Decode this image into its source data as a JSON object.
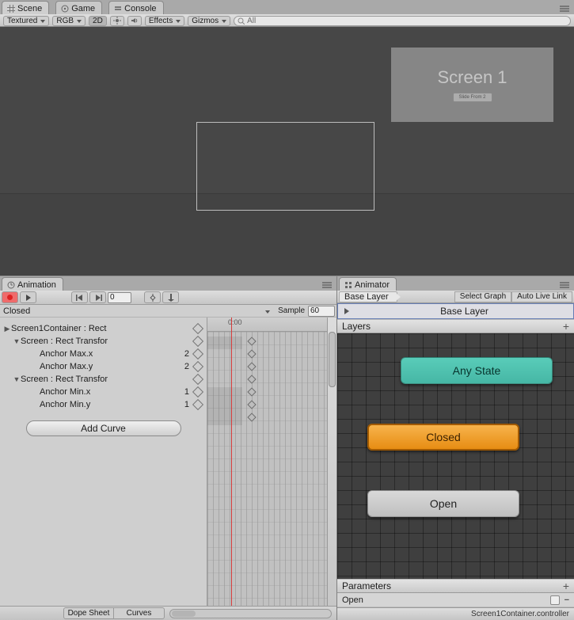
{
  "scene_tabs": {
    "scene": "Scene",
    "game": "Game",
    "console": "Console"
  },
  "scene_toolbar": {
    "render_mode": "Textured",
    "color_mode": "RGB",
    "btn_2d": "2D",
    "effects": "Effects",
    "gizmos": "Gizmos",
    "search_placeholder": "All"
  },
  "screen_card": {
    "title": "Screen 1",
    "subbtn": "Slide From 2"
  },
  "animation": {
    "tab": "Animation",
    "frame": "0",
    "clip": "Closed",
    "sample_label": "Sample",
    "sample_value": "60",
    "ruler0": "0:00",
    "add_curve": "Add Curve",
    "bottom_dope": "Dope Sheet",
    "bottom_curves": "Curves",
    "props": [
      {
        "indent": 0,
        "twist": "▶",
        "label": "Screen1Container : Rect",
        "val": "",
        "tint": "#a4cfa4"
      },
      {
        "indent": 1,
        "twist": "▼",
        "label": "Screen : Rect Transfor",
        "val": "",
        "tint": "#a4cfa4"
      },
      {
        "indent": 2,
        "twist": "",
        "label": "Anchor Max.x",
        "val": "2",
        "tint": "#a4cfa4"
      },
      {
        "indent": 2,
        "twist": "",
        "label": "Anchor Max.y",
        "val": "2",
        "tint": "#a4cfa4"
      },
      {
        "indent": 1,
        "twist": "▼",
        "label": "Screen : Rect Transfor",
        "val": "",
        "tint": "#a4cfa4"
      },
      {
        "indent": 2,
        "twist": "",
        "label": "Anchor Min.x",
        "val": "1",
        "tint": "#a4cfa4"
      },
      {
        "indent": 2,
        "twist": "",
        "label": "Anchor Min.y",
        "val": "1",
        "tint": "#a4cfa4"
      }
    ]
  },
  "animator": {
    "tab": "Animator",
    "breadcrumb": "Base Layer",
    "select_graph": "Select Graph",
    "auto_live_link": "Auto Live Link",
    "base_layer": "Base Layer",
    "layers": "Layers",
    "parameters": "Parameters",
    "nodes": {
      "any": "Any State",
      "closed": "Closed",
      "open": "Open"
    },
    "param": {
      "name": "Open"
    },
    "footer": "Screen1Container.controller"
  }
}
